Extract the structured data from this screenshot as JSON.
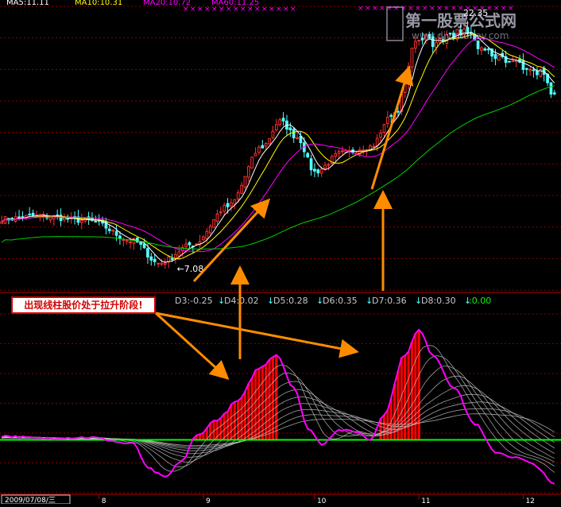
{
  "colors": {
    "background": "#000000",
    "grid": "#8b0000",
    "candle_up": "#ff3030",
    "candle_down": "#54ffff",
    "ma_fast": "#ffffff",
    "ma_mid": "#ffff00",
    "ma_slow": "#ff00ff",
    "ma_long": "#00d000",
    "arrow": "#ff8c00",
    "zero_line": "#00ff00",
    "osc_main": "#ff00ff",
    "osc_sub": "#c8c8c8",
    "hist": "#ff0000"
  },
  "header": {
    "ma_labels": [
      "MA5:11.11",
      "MA10:10.31",
      "MA20:10.72",
      "MA60:11.25"
    ]
  },
  "watermark": {
    "text": "第一股票公式网",
    "url": "www.diyimoney.com"
  },
  "callout": {
    "text": "出现线柱股价处于拉升阶段!"
  },
  "indicator_header": {
    "items": [
      "D3:-0.25",
      "D4:0.02",
      "D5:0.28",
      "D6:0.35",
      "D7:0.36",
      "D8:0.30"
    ],
    "tail_value": ":0.00"
  },
  "chart_data": [
    {
      "type": "candlestick",
      "series": [
        {
          "name": "MA5"
        },
        {
          "name": "MA10"
        },
        {
          "name": "MA20"
        },
        {
          "name": "MA60"
        }
      ],
      "high_label": "22.35",
      "low_label": "7.08",
      "anchors": [
        {
          "i": 0,
          "p": 10.0
        },
        {
          "i": 10,
          "p": 10.2
        },
        {
          "i": 25,
          "p": 9.9
        },
        {
          "i": 38,
          "p": 8.6
        },
        {
          "i": 45,
          "p": 7.2
        },
        {
          "i": 55,
          "p": 8.4
        },
        {
          "i": 65,
          "p": 10.8
        },
        {
          "i": 75,
          "p": 14.6
        },
        {
          "i": 80,
          "p": 16.2
        },
        {
          "i": 85,
          "p": 15.2
        },
        {
          "i": 90,
          "p": 13.0
        },
        {
          "i": 98,
          "p": 14.2
        },
        {
          "i": 106,
          "p": 14.6
        },
        {
          "i": 113,
          "p": 16.8
        },
        {
          "i": 120,
          "p": 21.6
        },
        {
          "i": 126,
          "p": 21.2
        },
        {
          "i": 133,
          "p": 21.9
        },
        {
          "i": 140,
          "p": 20.4
        },
        {
          "i": 147,
          "p": 20.0
        },
        {
          "i": 154,
          "p": 19.4
        },
        {
          "i": 159,
          "p": 17.8
        }
      ],
      "ylim": [
        5.5,
        23.5
      ]
    },
    {
      "type": "line",
      "series": [
        {
          "name": "D3",
          "values": [
            -0.25
          ]
        },
        {
          "name": "D4",
          "values": [
            0.02
          ]
        },
        {
          "name": "D5",
          "values": [
            0.28
          ]
        },
        {
          "name": "D6",
          "values": [
            0.35
          ]
        },
        {
          "name": "D7",
          "values": [
            0.36
          ]
        },
        {
          "name": "D8",
          "values": [
            0.3
          ]
        }
      ],
      "main_anchors": [
        {
          "i": 0,
          "v": 0.05
        },
        {
          "i": 10,
          "v": 0.02
        },
        {
          "i": 25,
          "v": 0.03
        },
        {
          "i": 38,
          "v": -0.05
        },
        {
          "i": 42,
          "v": -0.35
        },
        {
          "i": 47,
          "v": -0.46
        },
        {
          "i": 52,
          "v": -0.25
        },
        {
          "i": 56,
          "v": 0.05
        },
        {
          "i": 62,
          "v": 0.25
        },
        {
          "i": 68,
          "v": 0.48
        },
        {
          "i": 74,
          "v": 0.88
        },
        {
          "i": 79,
          "v": 1.05
        },
        {
          "i": 84,
          "v": 0.65
        },
        {
          "i": 88,
          "v": 0.15
        },
        {
          "i": 92,
          "v": -0.05
        },
        {
          "i": 97,
          "v": 0.12
        },
        {
          "i": 102,
          "v": 0.1
        },
        {
          "i": 106,
          "v": 0.0
        },
        {
          "i": 110,
          "v": 0.32
        },
        {
          "i": 116,
          "v": 1.05
        },
        {
          "i": 120,
          "v": 1.35
        },
        {
          "i": 124,
          "v": 1.05
        },
        {
          "i": 130,
          "v": 0.65
        },
        {
          "i": 136,
          "v": 0.2
        },
        {
          "i": 142,
          "v": -0.15
        },
        {
          "i": 148,
          "v": -0.22
        },
        {
          "i": 153,
          "v": -0.3
        },
        {
          "i": 159,
          "v": -0.55
        }
      ],
      "ylim": [
        -0.65,
        1.55
      ]
    }
  ],
  "date_axis": {
    "first_label": "2009/07/08/三",
    "month_labels": [
      "8",
      "9",
      "10",
      "11",
      "12"
    ]
  }
}
